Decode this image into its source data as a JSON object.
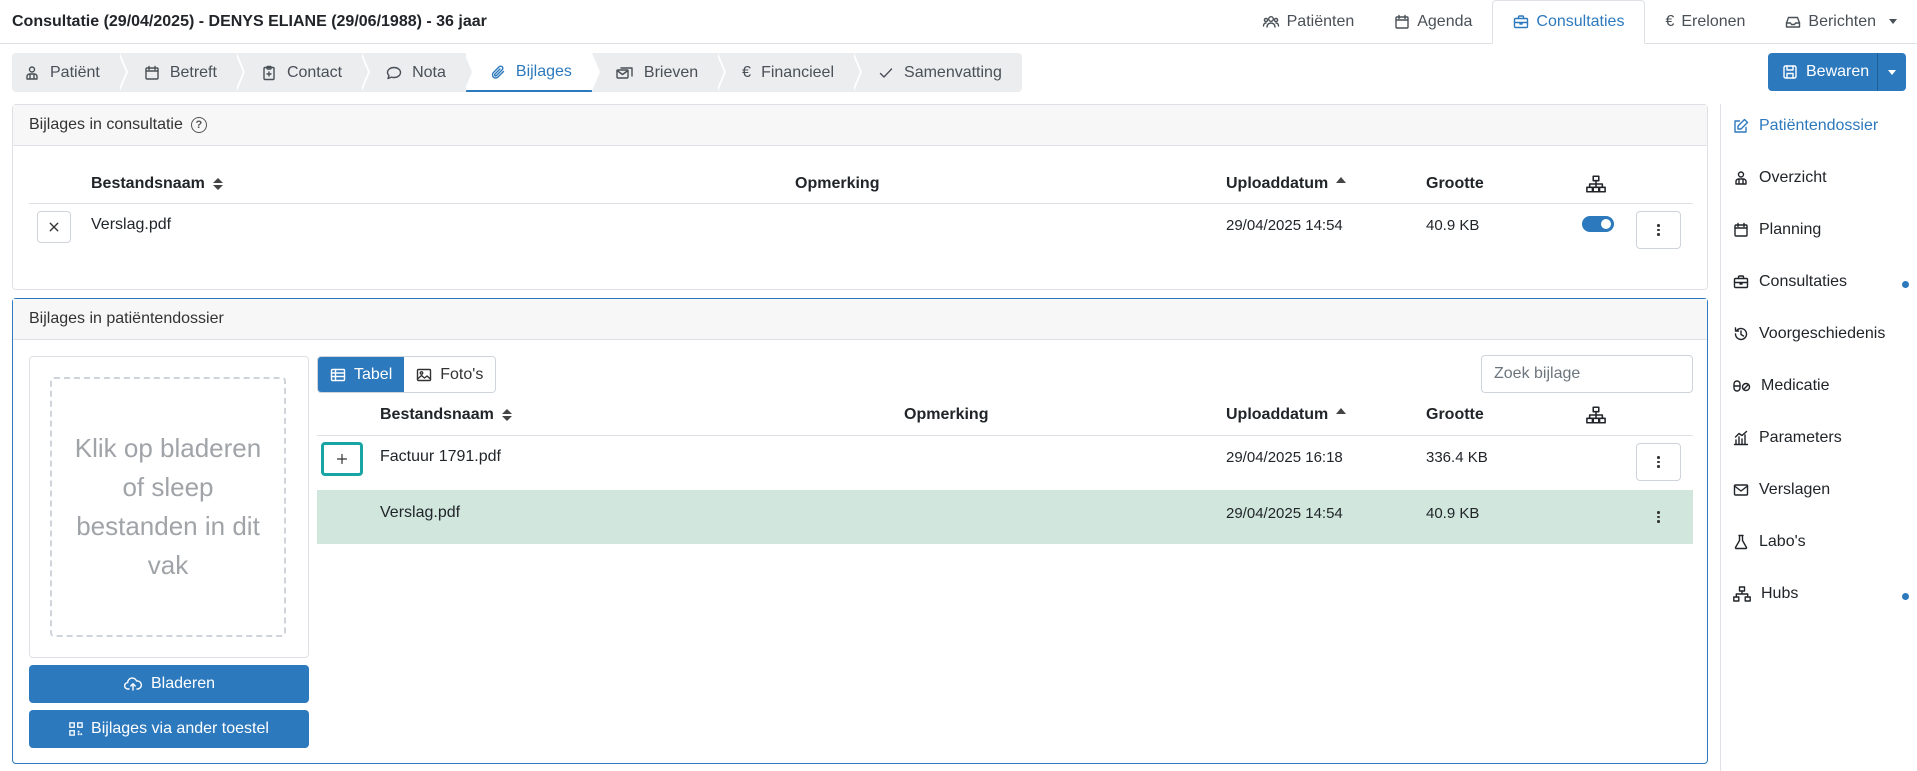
{
  "header": {
    "title": "Consultatie (29/04/2025) - DENYS ELIANE (29/06/1988) - 36 jaar",
    "nav": [
      {
        "label": "Patiënten",
        "icon": "users-icon"
      },
      {
        "label": "Agenda",
        "icon": "calendar-icon"
      },
      {
        "label": "Consultaties",
        "icon": "briefcase-icon",
        "active": true
      },
      {
        "label": "Erelonen",
        "icon": "euro-icon"
      },
      {
        "label": "Berichten",
        "icon": "inbox-icon"
      }
    ]
  },
  "steps": [
    {
      "label": "Patiënt",
      "icon": "person-icon"
    },
    {
      "label": "Betreft",
      "icon": "calendar-icon"
    },
    {
      "label": "Contact",
      "icon": "clipboard-icon"
    },
    {
      "label": "Nota",
      "icon": "chat-icon"
    },
    {
      "label": "Bijlages",
      "icon": "paperclip-icon",
      "active": true
    },
    {
      "label": "Brieven",
      "icon": "letters-icon"
    },
    {
      "label": "Financieel",
      "icon": "euro-icon"
    },
    {
      "label": "Samenvatting",
      "icon": "check-icon"
    }
  ],
  "save_label": "Bewaren",
  "consult_panel": {
    "title": "Bijlages in consultatie",
    "headers": {
      "filename": "Bestandsnaam",
      "remark": "Opmerking",
      "upload": "Uploaddatum",
      "size": "Grootte"
    },
    "rows": [
      {
        "filename": "Verslag.pdf",
        "remark": "",
        "upload": "29/04/2025 14:54",
        "size": "40.9 KB",
        "shared": true
      }
    ]
  },
  "patient_panel": {
    "title": "Bijlages in patiëntendossier",
    "dropzone_text": "Klik op bladeren of sleep bestanden in dit vak",
    "browse_label": "Bladeren",
    "other_device_label": "Bijlages via ander toestel",
    "view_tabs": [
      {
        "label": "Tabel",
        "icon": "table-icon",
        "active": true
      },
      {
        "label": "Foto's",
        "icon": "image-icon"
      }
    ],
    "search_placeholder": "Zoek bijlage",
    "headers": {
      "filename": "Bestandsnaam",
      "remark": "Opmerking",
      "upload": "Uploaddatum",
      "size": "Grootte"
    },
    "rows": [
      {
        "filename": "Factuur 1791.pdf",
        "remark": "",
        "upload": "29/04/2025 16:18",
        "size": "336.4 KB"
      },
      {
        "filename": "Verslag.pdf",
        "remark": "",
        "upload": "29/04/2025 14:54",
        "size": "40.9 KB",
        "in_consult": true
      }
    ]
  },
  "sidebar": {
    "items": [
      {
        "label": "Patiëntendossier",
        "icon": "edit-icon",
        "link": true
      },
      {
        "label": "Overzicht",
        "icon": "person-icon"
      },
      {
        "label": "Planning",
        "icon": "calendar-icon"
      },
      {
        "label": "Consultaties",
        "icon": "briefcase-icon",
        "dot": true
      },
      {
        "label": "Voorgeschiedenis",
        "icon": "history-icon"
      },
      {
        "label": "Medicatie",
        "icon": "pills-icon"
      },
      {
        "label": "Parameters",
        "icon": "chart-icon"
      },
      {
        "label": "Verslagen",
        "icon": "envelope-icon"
      },
      {
        "label": "Labo's",
        "icon": "flask-icon"
      },
      {
        "label": "Hubs",
        "icon": "network-icon",
        "dot": true
      }
    ]
  },
  "colors": {
    "accent": "#2d79bd",
    "highlight_row": "#d1e7dd",
    "focus_outline": "#1aa5a5"
  }
}
